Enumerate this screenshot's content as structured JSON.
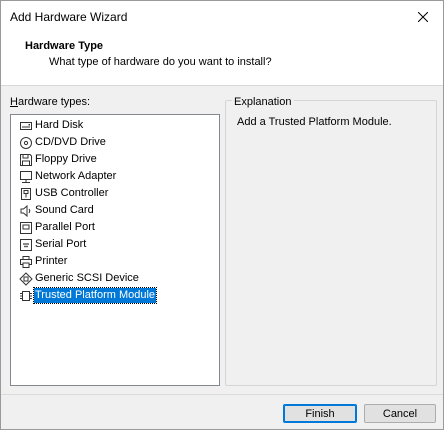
{
  "window": {
    "title": "Add Hardware Wizard",
    "close_icon": "close-icon"
  },
  "header": {
    "title": "Hardware Type",
    "subtitle": "What type of hardware do you want to install?"
  },
  "hardware_list": {
    "label": "Hardware types:",
    "items": [
      {
        "label": "Hard Disk",
        "icon": "hard-disk-icon"
      },
      {
        "label": "CD/DVD Drive",
        "icon": "cd-dvd-icon"
      },
      {
        "label": "Floppy Drive",
        "icon": "floppy-icon"
      },
      {
        "label": "Network Adapter",
        "icon": "network-adapter-icon"
      },
      {
        "label": "USB Controller",
        "icon": "usb-icon"
      },
      {
        "label": "Sound Card",
        "icon": "speaker-icon"
      },
      {
        "label": "Parallel Port",
        "icon": "parallel-port-icon"
      },
      {
        "label": "Serial Port",
        "icon": "serial-port-icon"
      },
      {
        "label": "Printer",
        "icon": "printer-icon"
      },
      {
        "label": "Generic SCSI Device",
        "icon": "scsi-device-icon"
      },
      {
        "label": "Trusted Platform Module",
        "icon": "tpm-chip-icon",
        "selected": true
      }
    ]
  },
  "explanation": {
    "legend": "Explanation",
    "text": "Add a Trusted Platform Module."
  },
  "buttons": {
    "finish": "Finish",
    "cancel": "Cancel"
  },
  "colors": {
    "selection": "#0078d7",
    "background": "#f0f0f0"
  }
}
